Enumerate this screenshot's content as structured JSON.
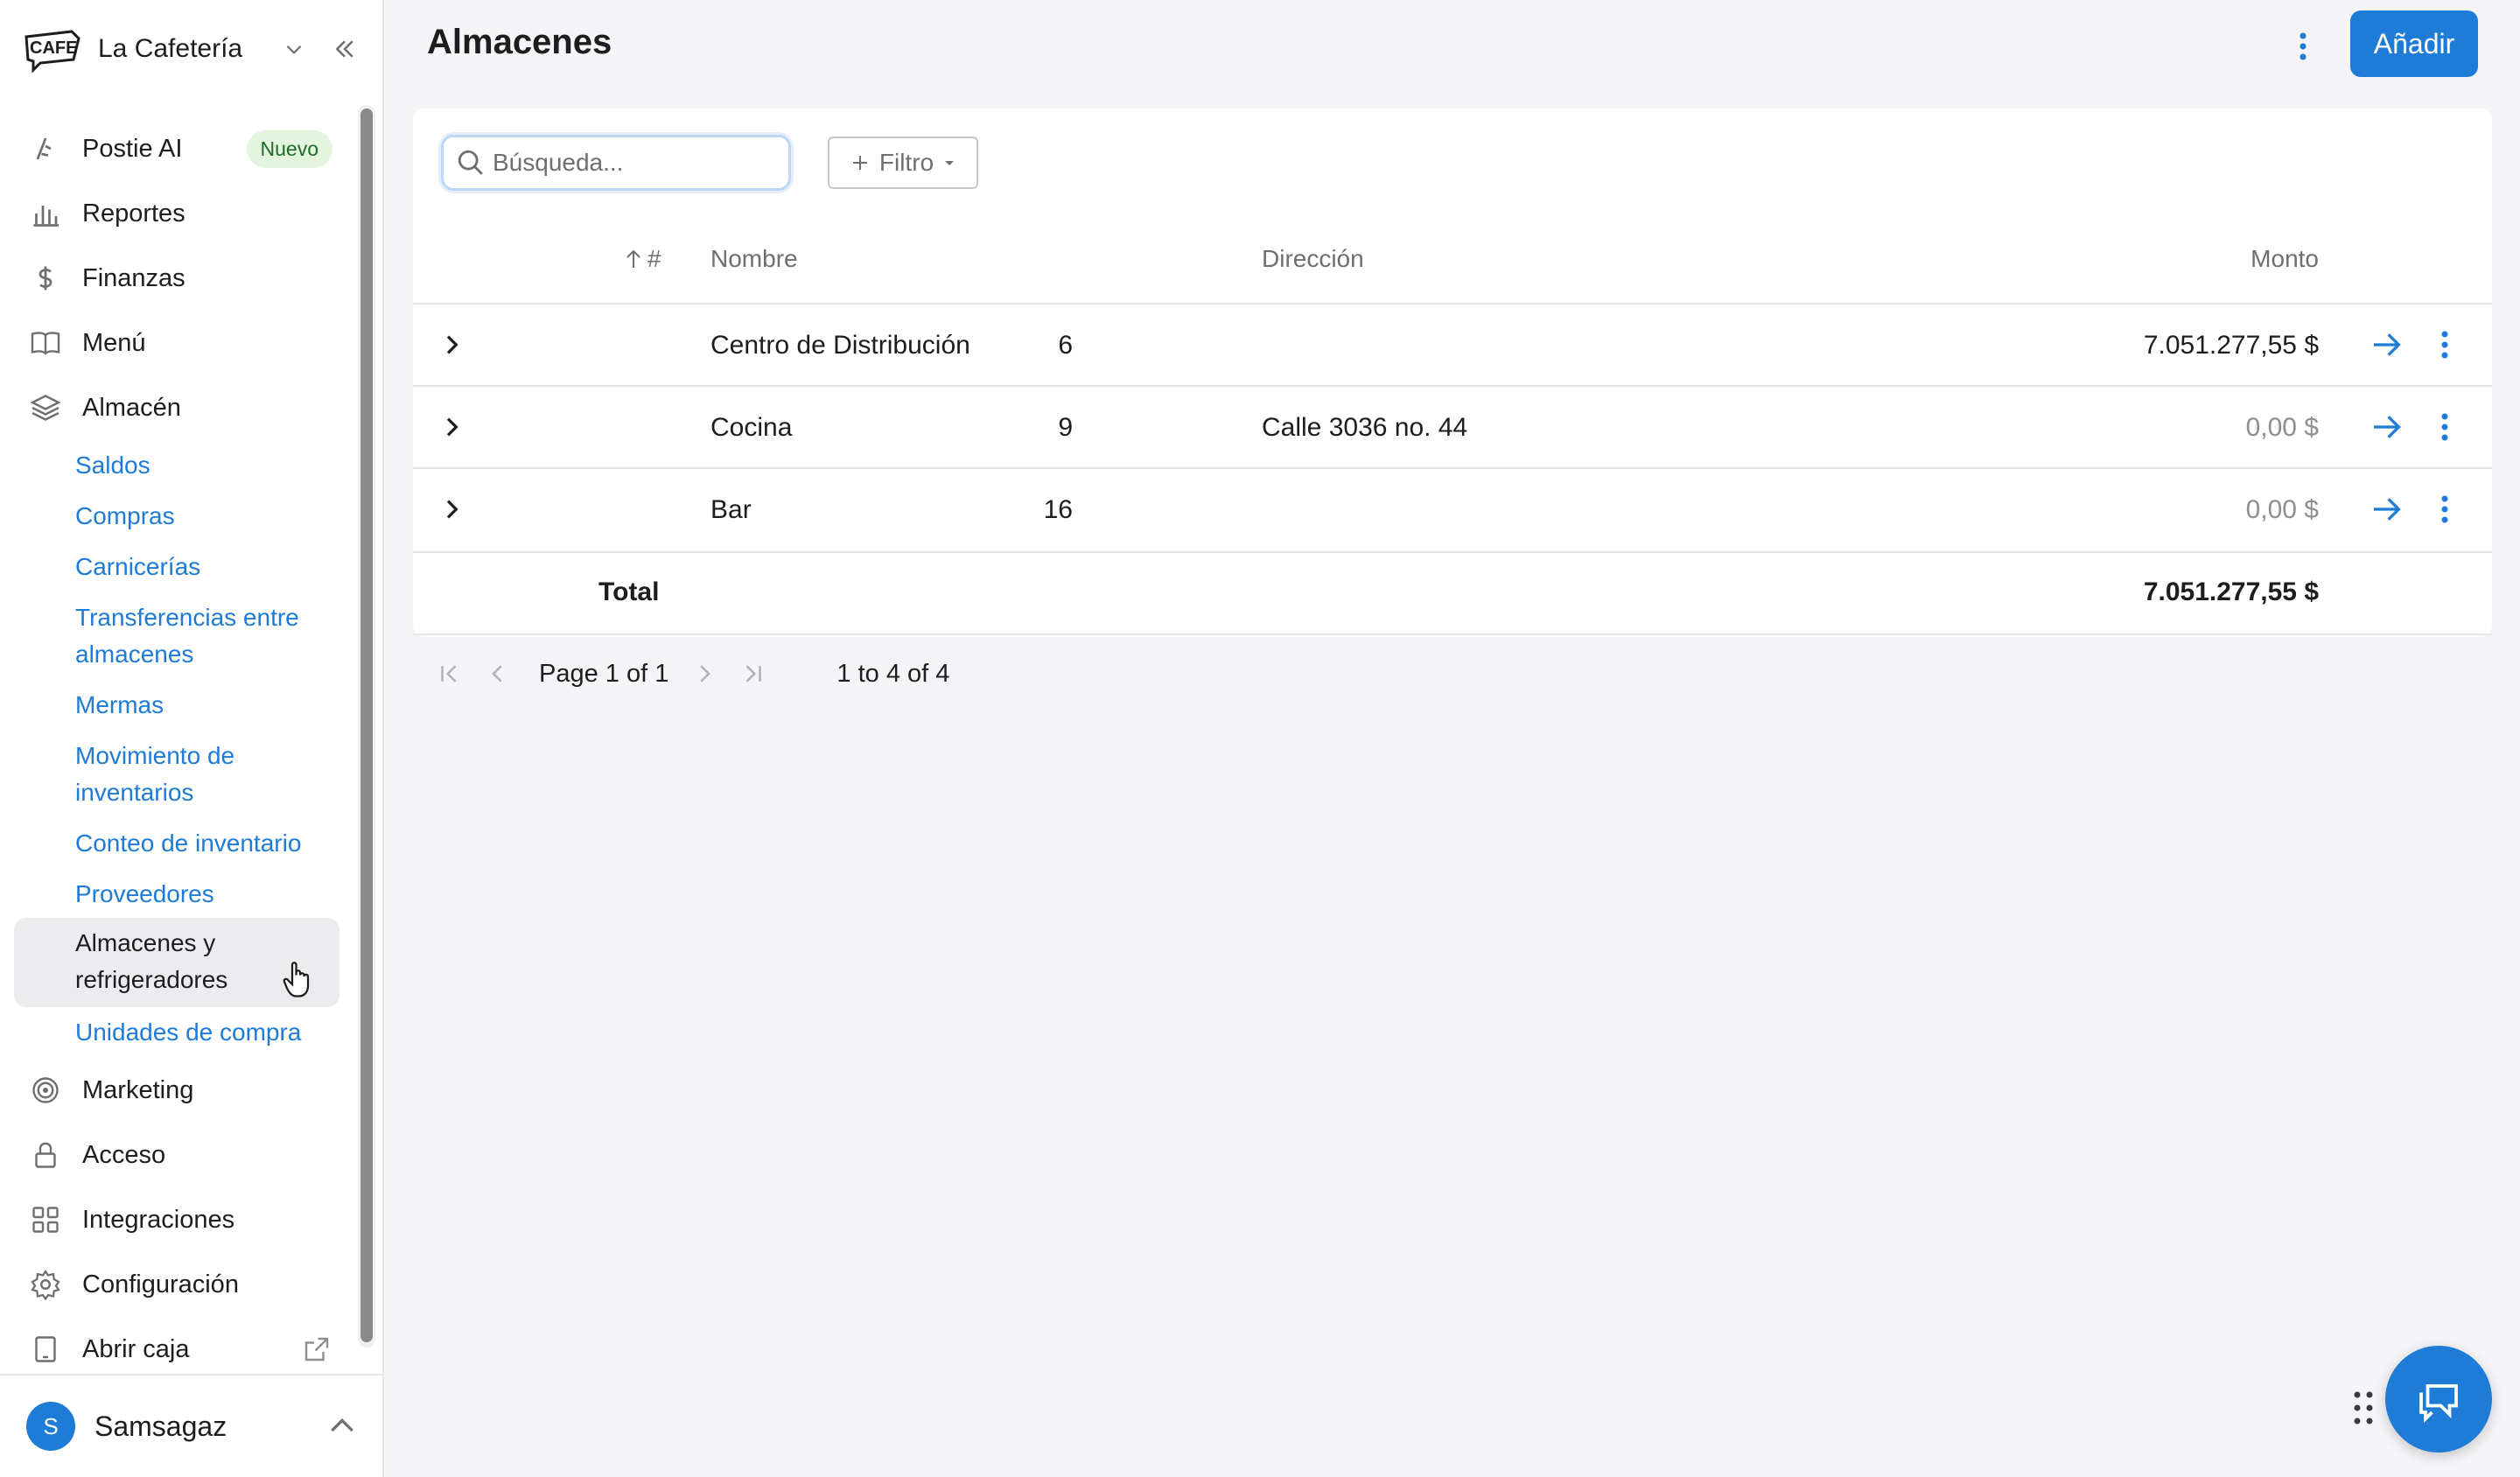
{
  "sidebar": {
    "brand": {
      "name": "La Cafetería",
      "logo_text": "CAFE"
    },
    "items": [
      {
        "label": "Postie AI",
        "icon": "sparkle-icon",
        "badge": "Nuevo"
      },
      {
        "label": "Reportes",
        "icon": "bar-chart-icon"
      },
      {
        "label": "Finanzas",
        "icon": "dollar-icon"
      },
      {
        "label": "Menú",
        "icon": "book-icon"
      },
      {
        "label": "Almacén",
        "icon": "layers-icon"
      }
    ],
    "almacen_sub": [
      "Saldos",
      "Compras",
      "Carnicerías",
      "Transferencias entre almacenes",
      "Mermas",
      "Movimiento de inventarios",
      "Conteo de inventario",
      "Proveedores",
      "Almacenes y refrigeradores",
      "Unidades de compra"
    ],
    "active_sub": "Almacenes y refrigeradores",
    "bottom_items": [
      {
        "label": "Marketing",
        "icon": "target-icon"
      },
      {
        "label": "Acceso",
        "icon": "lock-icon"
      },
      {
        "label": "Integraciones",
        "icon": "grid-icon"
      },
      {
        "label": "Configuración",
        "icon": "gear-icon"
      },
      {
        "label": "Abrir caja",
        "icon": "tablet-icon"
      }
    ],
    "user": {
      "initial": "S",
      "name": "Samsagaz"
    }
  },
  "header": {
    "title": "Almacenes",
    "add_label": "Añadir"
  },
  "toolbar": {
    "search_placeholder": "Búsqueda...",
    "filter_label": "Filtro"
  },
  "table": {
    "columns": {
      "id": "#",
      "name": "Nombre",
      "address": "Dirección",
      "amount": "Monto"
    },
    "sort": {
      "column": "#",
      "direction": "asc"
    },
    "rows": [
      {
        "id": "6",
        "name": "Centro de Distribución",
        "address": "",
        "amount": "7.051.277,55 $"
      },
      {
        "id": "9",
        "name": "Cocina",
        "address": "Calle 3036 no. 44",
        "amount": "0,00 $"
      },
      {
        "id": "16",
        "name": "Bar",
        "address": "",
        "amount": "0,00 $"
      }
    ],
    "total_label": "Total",
    "total_amount": "7.051.277,55 $"
  },
  "pagination": {
    "page_word": "Page",
    "current": "1",
    "of_word": "of",
    "total_pages": "1",
    "range_text": "1 to 4 of 4"
  },
  "colors": {
    "accent": "#1e7bd6",
    "badge_bg": "#e3f5df",
    "active_bg": "#ececef"
  }
}
